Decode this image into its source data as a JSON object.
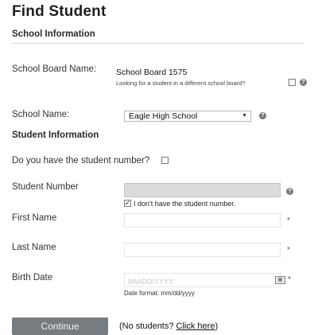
{
  "header": {
    "title": "Find Student"
  },
  "school_section": {
    "heading": "School Information",
    "board_label": "School Board Name:",
    "board_value": "School Board 1575",
    "different_board_text": "Looking for a student in a different school board?",
    "school_name_label": "School Name:",
    "school_name_value": "Eagle High School"
  },
  "student_section": {
    "heading": "Student Information",
    "have_number_question": "Do you have the student number?",
    "student_number_label": "Student Number",
    "dont_have_number_text": "I don't have the student number.",
    "dont_have_number_checked": true,
    "first_name_label": "First Name",
    "last_name_label": "Last Name",
    "birth_date_label": "Birth Date",
    "birth_date_placeholder": "MM/DD/YYYY",
    "date_format_note": "Date format: mm/dd/yyyy",
    "required_marker": "*"
  },
  "actions": {
    "continue_label": "Continue",
    "no_students_prefix": "(No students? ",
    "click_here_label": "Click here",
    "no_students_suffix": ")"
  },
  "icons": {
    "help": "help-icon",
    "dropdown": "chevron-down-icon",
    "calendar": "calendar-icon"
  }
}
